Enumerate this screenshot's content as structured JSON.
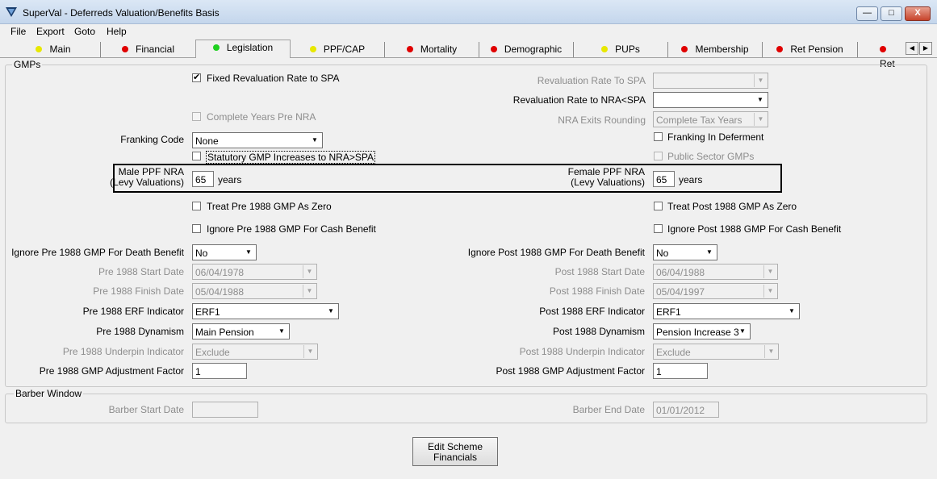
{
  "window": {
    "title": "SuperVal - Deferreds Valuation/Benefits Basis",
    "minimize_label": "—",
    "maximize_label": "□",
    "close_label": "X"
  },
  "menu": [
    "File",
    "Export",
    "Goto",
    "Help"
  ],
  "tabs": [
    {
      "label": "Main",
      "status_color": "#e8e800"
    },
    {
      "label": "Financial",
      "status_color": "#e00000"
    },
    {
      "label": "Legislation",
      "status_color": "#1fd020",
      "active": true
    },
    {
      "label": "PPF/CAP",
      "status_color": "#e8e800"
    },
    {
      "label": "Mortality",
      "status_color": "#e00000"
    },
    {
      "label": "Demographic",
      "status_color": "#e00000"
    },
    {
      "label": "PUPs",
      "status_color": "#e8e800"
    },
    {
      "label": "Membership",
      "status_color": "#e00000"
    },
    {
      "label": "Ret Pension",
      "status_color": "#e00000"
    },
    {
      "label": "Ret",
      "status_color": "#e00000"
    }
  ],
  "tab_scroll": {
    "left": "◀",
    "right": "▶"
  },
  "gmps": {
    "title": "GMPs",
    "fixed_revaluation": {
      "label": "Fixed Revaluation Rate to SPA",
      "checked": true,
      "mark": "✔"
    },
    "revaluation_rate_spa": {
      "label": "Revaluation Rate To SPA",
      "value": ""
    },
    "revaluation_rate_nra": {
      "label": "Revaluation Rate to NRA<SPA",
      "value": ""
    },
    "complete_years": {
      "label": "Complete Years Pre NRA",
      "checked": false
    },
    "nra_exits_rounding": {
      "label": "NRA Exits Rounding",
      "value": "Complete Tax Years"
    },
    "franking_code": {
      "label": "Franking Code",
      "value": "None"
    },
    "franking_in_deferment": {
      "label": "Franking In Deferment",
      "checked": false
    },
    "statutory_gmp": {
      "label": "Statutory GMP Increases to NRA>SPA",
      "checked": false
    },
    "public_sector_gmps": {
      "label": "Public Sector GMPs",
      "checked": false
    },
    "male_ppf_nra": {
      "label_line1": "Male PPF NRA",
      "label_line2": "(Levy Valuations)",
      "value": "65",
      "unit": "years"
    },
    "female_ppf_nra": {
      "label_line1": "Female PPF NRA",
      "label_line2": "(Levy Valuations)",
      "value": "65",
      "unit": "years"
    },
    "treat_pre_zero": {
      "label": "Treat Pre 1988 GMP As Zero",
      "checked": false
    },
    "treat_post_zero": {
      "label": "Treat Post 1988 GMP As Zero",
      "checked": false
    },
    "ignore_pre_cash": {
      "label": "Ignore Pre 1988 GMP For Cash Benefit",
      "checked": false
    },
    "ignore_post_cash": {
      "label": "Ignore Post 1988 GMP For Cash Benefit",
      "checked": false
    },
    "ignore_pre_death": {
      "label": "Ignore Pre 1988 GMP For Death Benefit",
      "value": "No"
    },
    "ignore_post_death": {
      "label": "Ignore Post 1988 GMP For Death Benefit",
      "value": "No"
    },
    "pre_start": {
      "label": "Pre 1988 Start Date",
      "value": "06/04/1978"
    },
    "post_start": {
      "label": "Post 1988 Start Date",
      "value": "06/04/1988"
    },
    "pre_finish": {
      "label": "Pre 1988 Finish Date",
      "value": "05/04/1988"
    },
    "post_finish": {
      "label": "Post 1988 Finish Date",
      "value": "05/04/1997"
    },
    "pre_erf": {
      "label": "Pre 1988 ERF Indicator",
      "value": "ERF1"
    },
    "post_erf": {
      "label": "Post 1988 ERF Indicator",
      "value": "ERF1"
    },
    "pre_dynamism": {
      "label": "Pre 1988 Dynamism",
      "value": "Main Pension"
    },
    "post_dynamism": {
      "label": "Post 1988 Dynamism",
      "value": "Pension Increase 3"
    },
    "pre_underpin": {
      "label": "Pre 1988 Underpin Indicator",
      "value": "Exclude"
    },
    "post_underpin": {
      "label": "Post 1988 Underpin Indicator",
      "value": "Exclude"
    },
    "pre_adj": {
      "label": "Pre 1988 GMP Adjustment Factor",
      "value": "1"
    },
    "post_adj": {
      "label": "Post 1988 GMP Adjustment Factor",
      "value": "1"
    }
  },
  "barber": {
    "title": "Barber Window",
    "start": {
      "label": "Barber Start Date",
      "value": ""
    },
    "end": {
      "label": "Barber End Date",
      "value": "01/01/2012"
    }
  },
  "edit_button": {
    "line1": "Edit Scheme",
    "line2": "Financials"
  },
  "icons": {
    "combo_arrow": "▼"
  }
}
